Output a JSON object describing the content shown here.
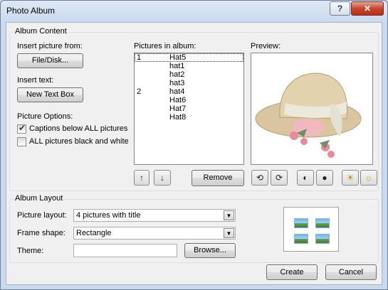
{
  "window": {
    "title": "Photo Album",
    "help_glyph": "?",
    "close_glyph": "✕"
  },
  "album_content": {
    "group_title": "Album Content",
    "insert_picture_label": "Insert picture from:",
    "file_disk_button": "File/Disk...",
    "insert_text_label": "Insert text:",
    "new_text_box_button": "New Text Box",
    "picture_options_label": "Picture Options:",
    "captions_checkbox": {
      "label": "Captions below ALL pictures",
      "checked": true
    },
    "black_white_checkbox": {
      "label": "ALL pictures black and white",
      "checked": false
    },
    "pictures_in_album_label": "Pictures in album:",
    "pictures": [
      {
        "num": "1",
        "name": "Hat5",
        "selected": true
      },
      {
        "num": "",
        "name": "hat1",
        "selected": false
      },
      {
        "num": "",
        "name": "hat2",
        "selected": false
      },
      {
        "num": "",
        "name": "hat3",
        "selected": false
      },
      {
        "num": "2",
        "name": "hat4",
        "selected": false
      },
      {
        "num": "",
        "name": "Hat6",
        "selected": false
      },
      {
        "num": "",
        "name": "Hat7",
        "selected": false
      },
      {
        "num": "",
        "name": "Hat8",
        "selected": false
      }
    ],
    "move_up_glyph": "↑",
    "move_down_glyph": "↓",
    "remove_button": "Remove",
    "preview_label": "Preview:"
  },
  "album_layout": {
    "group_title": "Album Layout",
    "picture_layout_label": "Picture layout:",
    "picture_layout_value": "4 pictures with title",
    "frame_shape_label": "Frame shape:",
    "frame_shape_value": "Rectangle",
    "theme_label": "Theme:",
    "theme_value": "",
    "browse_button": "Browse..."
  },
  "buttons": {
    "create": "Create",
    "cancel": "Cancel"
  },
  "colors": {
    "accent": "#3399ff",
    "window_frame": "#c9d9ee",
    "close_button": "#c6452c"
  }
}
